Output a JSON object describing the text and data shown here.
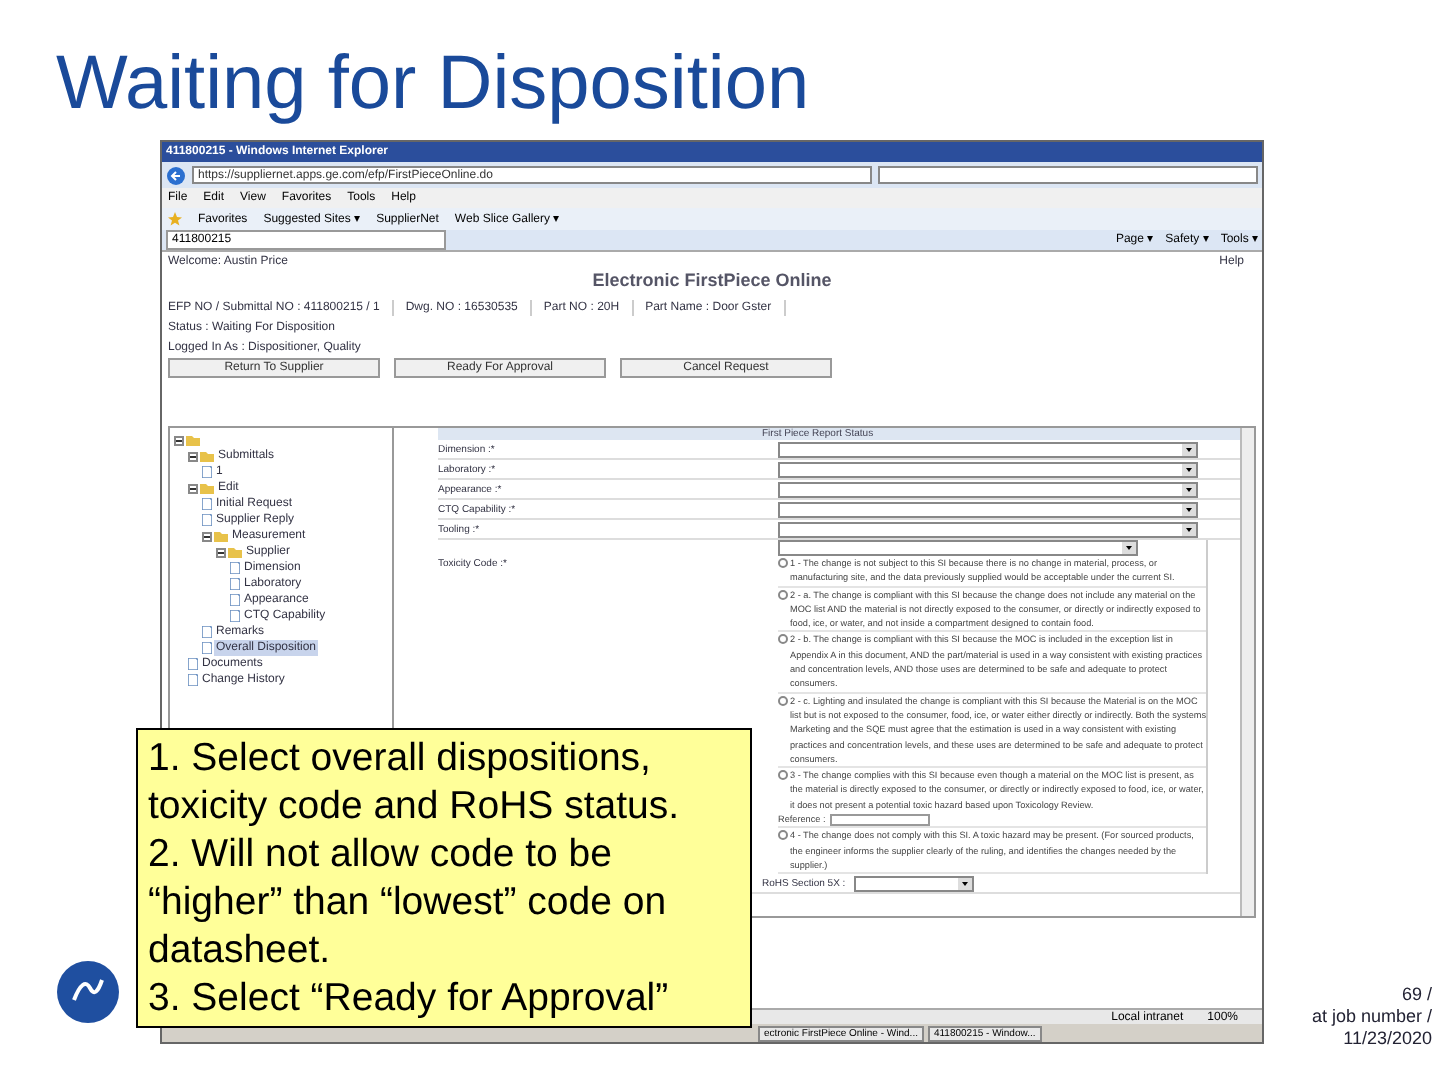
{
  "slide_title": "Waiting for Disposition",
  "browser": {
    "title": "411800215 - Windows Internet Explorer",
    "address": "https://suppliernet.apps.ge.com/efp/FirstPieceOnline.do",
    "menu": [
      "File",
      "Edit",
      "View",
      "Favorites",
      "Tools",
      "Help"
    ],
    "favorites": [
      "Favorites",
      "Suggested Sites ▾",
      "SupplierNet",
      "Web Slice Gallery ▾"
    ],
    "tab": "411800215",
    "tools": [
      "Page ▾",
      "Safety ▾",
      "Tools ▾"
    ]
  },
  "page": {
    "welcome": "Welcome: Austin Price",
    "help": "Help",
    "app_title": "Electronic FirstPiece Online",
    "info": [
      "EFP NO / Submittal NO : 411800215 / 1",
      "Dwg. NO : 16530535",
      "Part NO : 20H",
      "Part Name : Door Gster"
    ],
    "status": "Status : Waiting For Disposition",
    "logged_in": "Logged In As : Dispositioner, Quality",
    "buttons": [
      "Return To Supplier",
      "Ready For Approval",
      "Cancel Request"
    ]
  },
  "tree": [
    {
      "expanded": true,
      "children": [
        {
          "label": "Submittals",
          "expanded": true,
          "selected": false,
          "children": [
            {
              "label": "1",
              "selected": false
            }
          ]
        },
        {
          "label": "Edit",
          "expanded": true,
          "selected": false,
          "children": [
            {
              "label": "Initial Request",
              "selected": false
            },
            {
              "label": "Supplier Reply",
              "selected": false
            },
            {
              "label": "Measurement",
              "expanded": true,
              "selected": false,
              "children": [
                {
                  "label": "Supplier",
                  "expanded": true,
                  "selected": false,
                  "children": [
                    {
                      "label": "Dimension",
                      "selected": false
                    },
                    {
                      "label": "Laboratory",
                      "selected": false
                    },
                    {
                      "label": "Appearance",
                      "selected": false
                    },
                    {
                      "label": "CTQ Capability",
                      "selected": false
                    }
                  ]
                }
              ]
            },
            {
              "label": "Remarks",
              "selected": false
            },
            {
              "label": "Overall Disposition",
              "selected": true
            }
          ]
        },
        {
          "label": "Documents",
          "selected": false
        },
        {
          "label": "Change History",
          "selected": false
        }
      ]
    }
  ],
  "form": {
    "heading": "First Piece Report Status",
    "fields": [
      {
        "label": "Dimension :*"
      },
      {
        "label": "Laboratory :*"
      },
      {
        "label": "Appearance :*"
      },
      {
        "label": "CTQ Capability :*"
      },
      {
        "label": "Tooling :*"
      }
    ],
    "toxicity_label": "Toxicity Code :*",
    "options": [
      {
        "text": "1 - The change is not subject to this SI because there is no change in material, process, or manufacturing site, and the data previously supplied would be acceptable under the current SI.",
        "selected": false
      },
      {
        "text": "2 - a. The change is compliant with this SI because the change does not include any material on the MOC list AND the material is not directly exposed to the consumer, or directly or indirectly exposed to food, ice, or water, and not inside a compartment designed to contain food.",
        "selected": false
      },
      {
        "text": "2 - b. The change is compliant with this SI because the MOC is included in the exception list in Appendix A in this document, AND the part/material is used in a way consistent with existing practices and concentration levels, AND those uses are determined to be safe and adequate to protect consumers.",
        "selected": false
      },
      {
        "text": "2 - c. Lighting and insulated the change is compliant with this SI because the Material is on the MOC list but is not exposed to the consumer, food, ice, or water either directly or indirectly. Both the systems Marketing and the SQE must agree that the estimation is used in a way consistent with existing practices and concentration levels, and these uses are determined to be safe and adequate to protect consumers.",
        "selected": false
      },
      {
        "text": "3 - The change complies with this SI because even though a material on the MOC list is present, as the material is directly exposed to the consumer, or directly or indirectly exposed to food, ice, or water, it does not present a potential toxic hazard based upon Toxicology Review.",
        "selected": false,
        "reference": "Reference :"
      },
      {
        "text": "4 - The change does not comply with this SI. A toxic hazard may be present. (For sourced products, the engineer informs the supplier clearly of the ruling, and identifies the changes needed by the supplier.)",
        "selected": false
      }
    ],
    "rohs_label": "RoHS Section 5X :"
  },
  "status_bar": {
    "zone": "Local intranet",
    "zoom": "100%"
  },
  "taskbar": [
    "ectronic FirstPiece Online - Wind...",
    "411800215 - Window..."
  ],
  "callout": [
    "1. Select overall dispositions,",
    "toxicity code and RoHS status.",
    "2. Will not allow code to be",
    "“higher” than “lowest” code on",
    "datasheet.",
    "3. Select “Ready for Approval”"
  ],
  "footer": [
    "69 /",
    "at job number /",
    "11/23/2020"
  ]
}
